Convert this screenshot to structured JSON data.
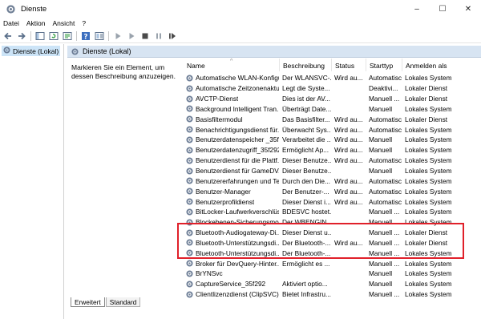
{
  "window": {
    "title": "Dienste",
    "controls": [
      "–",
      "☐",
      "✕"
    ]
  },
  "menu": [
    "Datei",
    "Aktion",
    "Ansicht",
    "?"
  ],
  "toolbar": {
    "icons": [
      "back-icon",
      "forward-icon",
      "console-tree-icon",
      "refresh-icon",
      "export-list-icon",
      "help-icon",
      "properties-icon",
      "start-service-icon",
      "start-service-alt-icon",
      "stop-service-icon",
      "pause-service-icon",
      "restart-service-icon"
    ]
  },
  "tree": {
    "root_label": "Dienste (Lokal)"
  },
  "panel": {
    "header": "Dienste (Lokal)",
    "description": "Markieren Sie ein Element, um dessen Beschreibung anzuzeigen."
  },
  "columns": [
    "Name",
    "Beschreibung",
    "Status",
    "Starttyp",
    "Anmelden als"
  ],
  "services": [
    {
      "name": "Automatische WLAN-Konfigu...",
      "desc": "Der WLANSVC-...",
      "status": "Wird au...",
      "start": "Automatisch",
      "logon": "Lokales System"
    },
    {
      "name": "Automatische Zeitzonenaktu...",
      "desc": "Legt die Syste...",
      "status": "",
      "start": "Deaktivi...",
      "logon": "Lokaler Dienst"
    },
    {
      "name": "AVCTP-Dienst",
      "desc": "Dies ist der AV...",
      "status": "",
      "start": "Manuell ...",
      "logon": "Lokaler Dienst"
    },
    {
      "name": "Background Intelligent Tran...",
      "desc": "Überträgt Date...",
      "status": "",
      "start": "Manuell",
      "logon": "Lokales System"
    },
    {
      "name": "Basisfiltermodul",
      "desc": "Das Basisfilter...",
      "status": "Wird au...",
      "start": "Automatisch",
      "logon": "Lokaler Dienst"
    },
    {
      "name": "Benachrichtigungsdienst für...",
      "desc": "Überwacht Sys...",
      "status": "Wird au...",
      "start": "Automatisch",
      "logon": "Lokales System"
    },
    {
      "name": "Benutzerdatenspeicher _35f...",
      "desc": "Verarbeitet die ...",
      "status": "Wird au...",
      "start": "Manuell",
      "logon": "Lokales System"
    },
    {
      "name": "Benutzerdatenzugriff_35f292",
      "desc": "Ermöglicht Ap...",
      "status": "Wird au...",
      "start": "Manuell",
      "logon": "Lokales System"
    },
    {
      "name": "Benutzerdienst für die Plattf...",
      "desc": "Dieser Benutze...",
      "status": "Wird au...",
      "start": "Automatisch",
      "logon": "Lokales System"
    },
    {
      "name": "Benutzerdienst für GameDV...",
      "desc": "Dieser Benutze...",
      "status": "",
      "start": "Manuell",
      "logon": "Lokales System"
    },
    {
      "name": "Benutzererfahrungen und Tel...",
      "desc": "Durch den Die...",
      "status": "Wird au...",
      "start": "Automatisch",
      "logon": "Lokales System"
    },
    {
      "name": "Benutzer-Manager",
      "desc": "Der Benutzer-...",
      "status": "Wird au...",
      "start": "Automatisch",
      "logon": "Lokales System"
    },
    {
      "name": "Benutzerprofildienst",
      "desc": "Dieser Dienst i...",
      "status": "Wird au...",
      "start": "Automatisch",
      "logon": "Lokales System"
    },
    {
      "name": "BitLocker-Laufwerkverschlüs...",
      "desc": "BDESVC hostet...",
      "status": "",
      "start": "Manuell ...",
      "logon": "Lokales System"
    },
    {
      "name": "Blockebenen-Sicherungsmo...",
      "desc": "Der WBENGIN...",
      "status": "",
      "start": "Manuell",
      "logon": "Lokales System"
    },
    {
      "name": "Bluetooth-Audiogateway-Di...",
      "desc": "Dieser Dienst u...",
      "status": "",
      "start": "Manuell ...",
      "logon": "Lokaler Dienst"
    },
    {
      "name": "Bluetooth-Unterstützungsdi...",
      "desc": "Der Bluetooth-...",
      "status": "Wird au...",
      "start": "Manuell ...",
      "logon": "Lokaler Dienst"
    },
    {
      "name": "Bluetooth-Unterstützungsdi...",
      "desc": "Der Bluetooth-...",
      "status": "",
      "start": "Manuell ...",
      "logon": "Lokales System"
    },
    {
      "name": "Broker für DevQuery-Hinter...",
      "desc": "Ermöglicht es ...",
      "status": "",
      "start": "Manuell ...",
      "logon": "Lokales System"
    },
    {
      "name": "BrYNSvc",
      "desc": "",
      "status": "",
      "start": "Manuell",
      "logon": "Lokales System"
    },
    {
      "name": "CaptureService_35f292",
      "desc": "Aktiviert optio...",
      "status": "",
      "start": "Manuell",
      "logon": "Lokales System"
    },
    {
      "name": "Clientlizenzdienst (ClipSVC)",
      "desc": "Bietet Infrastru...",
      "status": "",
      "start": "Manuell ...",
      "logon": "Lokales System"
    }
  ],
  "tabs": [
    "Erweitert",
    "Standard"
  ],
  "colors": {
    "highlight": "#e0202a",
    "panel_header": "#d7e4f2",
    "selection": "#cce4f7"
  }
}
